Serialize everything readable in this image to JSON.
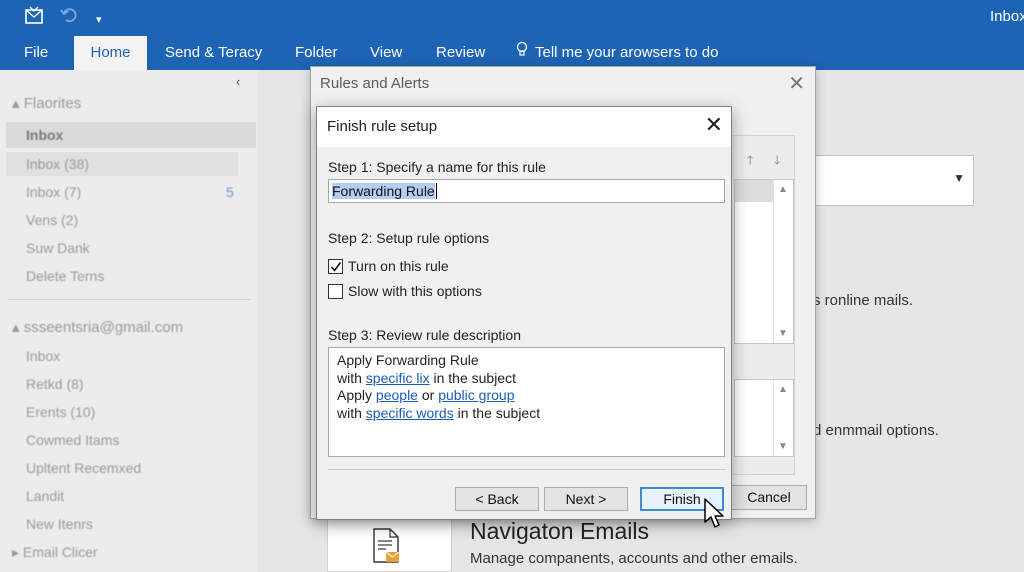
{
  "titlebar": {
    "app_title": "Inbox",
    "qa_icons": [
      "send-receive-icon",
      "undo-icon",
      "customize-quick-access-icon"
    ]
  },
  "ribbon": {
    "tabs": [
      {
        "label": "File"
      },
      {
        "label": "Home",
        "active": true
      },
      {
        "label": "Send & Teracy"
      },
      {
        "label": "Folder"
      },
      {
        "label": "View"
      },
      {
        "label": "Review"
      }
    ],
    "tell_me": "Tell me your arowsers to do"
  },
  "nav": {
    "collapse_glyph": "‹",
    "favorites_header": "Flaorites",
    "favorites": [
      {
        "label": "Inbox",
        "bold": true
      },
      {
        "label": "Inbox (38)"
      },
      {
        "label": "Inbox (7)",
        "badge": "5"
      },
      {
        "label": "Vens (2)"
      },
      {
        "label": "Suw Dank"
      },
      {
        "label": "Delete Terns"
      }
    ],
    "account_header": "ssseentsria@gmail.com",
    "folders": [
      "Inbox",
      "Retkd (8)",
      "Erents (10)",
      "Cowmed Itams",
      "Upltent Recemxed",
      "Landit",
      "New Itenrs",
      "Email Clicer"
    ]
  },
  "background": {
    "text1": "s ronline mails.",
    "text2": "d enmmail options.",
    "card_title": "Navigaton Emails",
    "card_sub": "Manage companents, accounts and other emails."
  },
  "rules_dialog": {
    "title": "Rules and Alerts",
    "cancel_label": "Cancel"
  },
  "finish_dialog": {
    "title": "Finish rule setup",
    "step1_label": "Step 1: Specify a name for this rule",
    "rule_name": "Forwarding Rule",
    "step2_label": "Step 2: Setup rule options",
    "options": [
      {
        "label": "Turn on this rule",
        "checked": true
      },
      {
        "label": "Slow with this options",
        "checked": false
      }
    ],
    "step3_label": "Step 3: Review rule description",
    "description": {
      "l1": "Apply Forwarding Rule",
      "l2_pre": "with ",
      "l2_link": "specific lix",
      "l2_post": " in the subject",
      "l3_pre": "Apply ",
      "l3_link1": "people",
      "l3_mid": " or ",
      "l3_link2": "public group",
      "l4_pre": "with ",
      "l4_link": "specific words",
      "l4_post": " in the subject"
    },
    "buttons": {
      "back": "< Back",
      "next": "Next >",
      "finish": "Finish"
    }
  },
  "colors": {
    "brand": "#1e64b5",
    "link": "#1a5bb5",
    "selection": "#b4cdf0",
    "focus_border": "#3b8bd6"
  }
}
